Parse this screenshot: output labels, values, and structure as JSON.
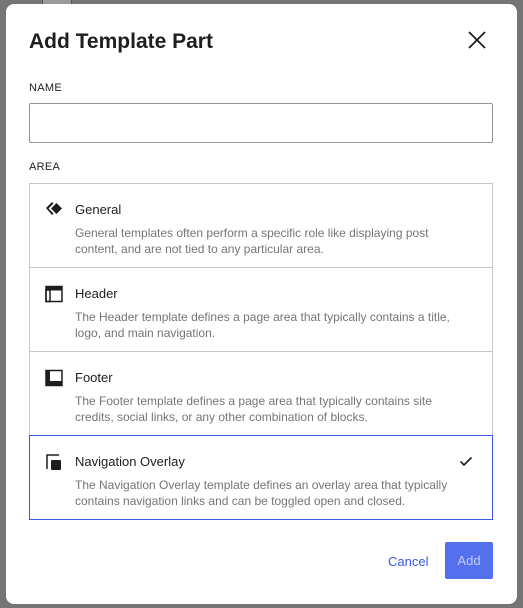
{
  "modal": {
    "title": "Add Template Part",
    "close_icon": "close-icon"
  },
  "name_field": {
    "label": "NAME",
    "value": "",
    "placeholder": ""
  },
  "area": {
    "label": "AREA",
    "selected": "Navigation Overlay",
    "options": [
      {
        "icon": "symbol-icon",
        "name": "General",
        "description": "General templates often perform a specific role like displaying post content, and are not tied to any particular area."
      },
      {
        "icon": "header-icon",
        "name": "Header",
        "description": "The Header template defines a page area that typically contains a title, logo, and main navigation."
      },
      {
        "icon": "footer-icon",
        "name": "Footer",
        "description": "The Footer template defines a page area that typically contains site credits, social links, or any other combination of blocks."
      },
      {
        "icon": "navigation-overlay-icon",
        "name": "Navigation Overlay",
        "description": "The Navigation Overlay template defines an overlay area that typically contains navigation links and can be toggled open and closed."
      }
    ]
  },
  "actions": {
    "cancel_label": "Cancel",
    "add_label": "Add"
  },
  "colors": {
    "accent": "#3858e9",
    "text": "#1e1e1e",
    "muted": "#757575",
    "border": "#c7c7c7",
    "backdrop": "#757575"
  }
}
